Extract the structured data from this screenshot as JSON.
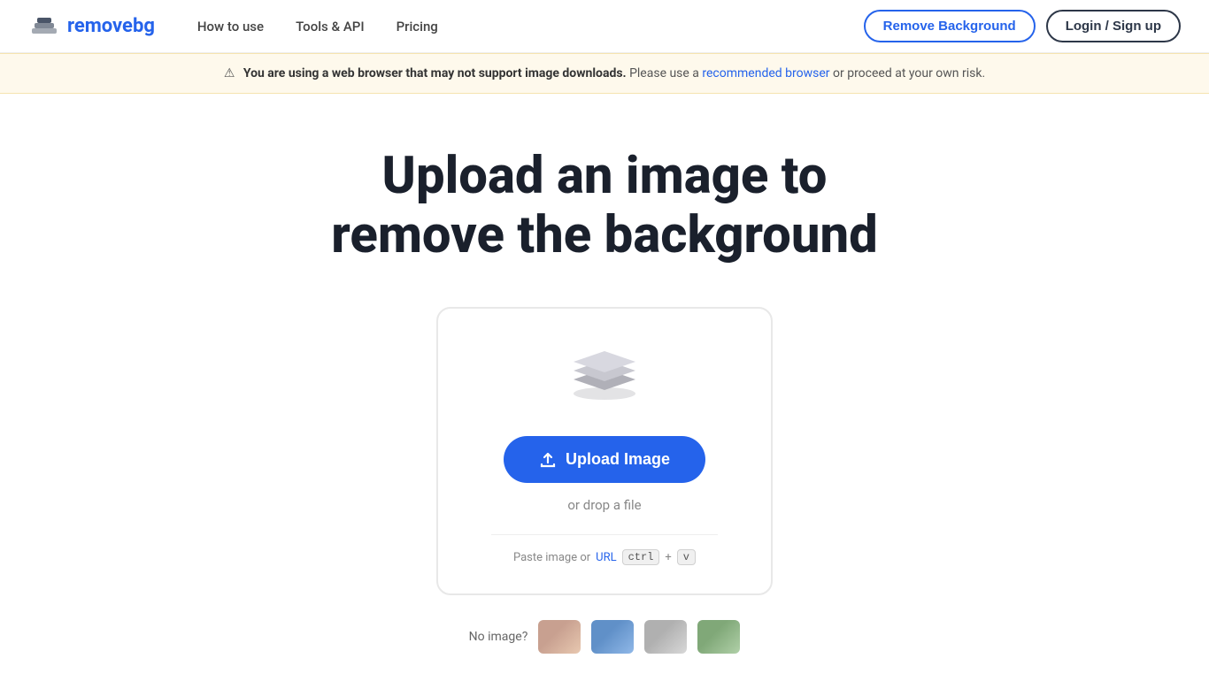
{
  "nav": {
    "logo_text_remove": "remove",
    "logo_text_bg": "bg",
    "links": [
      {
        "label": "How to use",
        "id": "how-to-use"
      },
      {
        "label": "Tools & API",
        "id": "tools-api"
      },
      {
        "label": "Pricing",
        "id": "pricing"
      }
    ],
    "btn_remove_bg": "Remove Background",
    "btn_login": "Login / Sign up"
  },
  "banner": {
    "warning_symbol": "⚠",
    "bold_text": "You are using a web browser that may not support image downloads.",
    "text_before_link": " Please use a ",
    "link_text": "recommended browser",
    "text_after_link": " or proceed at your own risk."
  },
  "hero": {
    "title_line1": "Upload an image to",
    "title_line2": "remove the background"
  },
  "upload": {
    "button_label": "Upload Image",
    "upload_icon": "⬆",
    "drop_text": "or drop a file",
    "paste_label": "Paste image or ",
    "url_link": "URL",
    "ctrl_key": "ctrl",
    "plus": "+",
    "v_key": "v"
  },
  "samples": {
    "label": "No image?",
    "thumbs": [
      {
        "id": "thumb-1",
        "color_class": "thumb-1"
      },
      {
        "id": "thumb-2",
        "color_class": "thumb-2"
      },
      {
        "id": "thumb-3",
        "color_class": "thumb-3"
      },
      {
        "id": "thumb-4",
        "color_class": "thumb-4"
      }
    ]
  }
}
